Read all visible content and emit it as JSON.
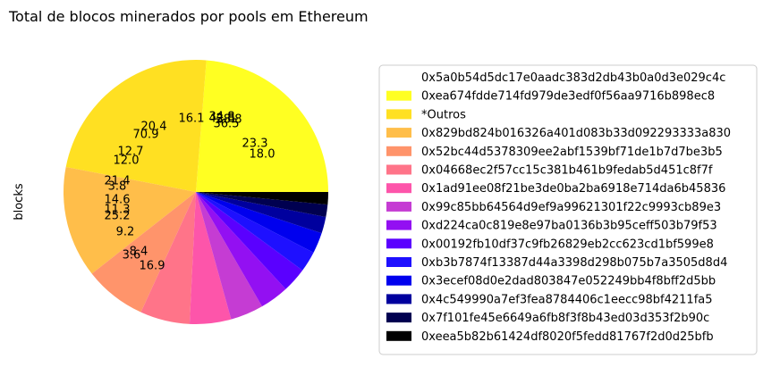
{
  "chart_data": {
    "type": "pie",
    "title": "Total de blocos minerados por pools em Ethereum",
    "ylabel": "blocks",
    "colormap": "gnuplot2_r",
    "legend_position": "right",
    "slices": [
      {
        "label": "0x5a0b54d5dc17e0aadc383d2db43b0a0d3e029c4c",
        "value": 0.0,
        "color": "#ffffff"
      },
      {
        "label": "0xea674fdde714fd979de3edf0f56aa9716b898ec8",
        "value": 23.5,
        "color": "#ffff22"
      },
      {
        "label": "*Outros",
        "value": 23.0,
        "color": "#ffe022"
      },
      {
        "label": "0x829bd824b016326a401d083b33d092293333a830",
        "value": 13.5,
        "color": "#ffbe4a"
      },
      {
        "label": "0x52bc44d5378309ee2abf1539bf71de1b7d7be3b5",
        "value": 7.5,
        "color": "#ff946b"
      },
      {
        "label": "0x04668ec2f57cc15c381b461b9fedab5d451c8f7f",
        "value": 6.0,
        "color": "#ff7489"
      },
      {
        "label": "0x1ad91ee08f21be3de0ba2ba6918e714da6b45836",
        "value": 5.0,
        "color": "#fd55aa"
      },
      {
        "label": "0x99c85bb64564d9ef9a99621301f22c9993cb89e3",
        "value": 4.0,
        "color": "#c53cd3"
      },
      {
        "label": "0xd224ca0c819e8e97ba0136b3b95ceff503b79f53",
        "value": 3.5,
        "color": "#9310f2"
      },
      {
        "label": "0x00192fb10df37c9fb26829eb2cc623cd1bf599e8",
        "value": 3.0,
        "color": "#5a00ff"
      },
      {
        "label": "0xb3b7874f13387d44a3398d298b075b7a3505d8d4",
        "value": 2.5,
        "color": "#1e10ff"
      },
      {
        "label": "0x3ecef08d0e2dad803847e052249bb4f8bff2d5bb",
        "value": 2.5,
        "color": "#0000ee"
      },
      {
        "label": "0x4c549990a7ef3fea8784406c1eecc98bf4211fa5",
        "value": 2.0,
        "color": "#00009e"
      },
      {
        "label": "0x7f101fe45e6649a6fb8f3f8b43ed03d353f2b90c",
        "value": 1.5,
        "color": "#000050"
      },
      {
        "label": "0xeea5b82b61424df8020f5fedd81767f2d0d25bfb",
        "value": 1.5,
        "color": "#000000"
      }
    ],
    "autopct_labels": [
      "16.1",
      "42.8",
      "20.4",
      "70.9",
      "12.7",
      "12.0",
      "21.4",
      "3.8",
      "14.6",
      "11.3",
      "25.2",
      "9.2",
      "8.4",
      "3.6",
      "16.9",
      "23.3",
      "18.0",
      "36.5",
      "34.8",
      "38.8"
    ]
  }
}
